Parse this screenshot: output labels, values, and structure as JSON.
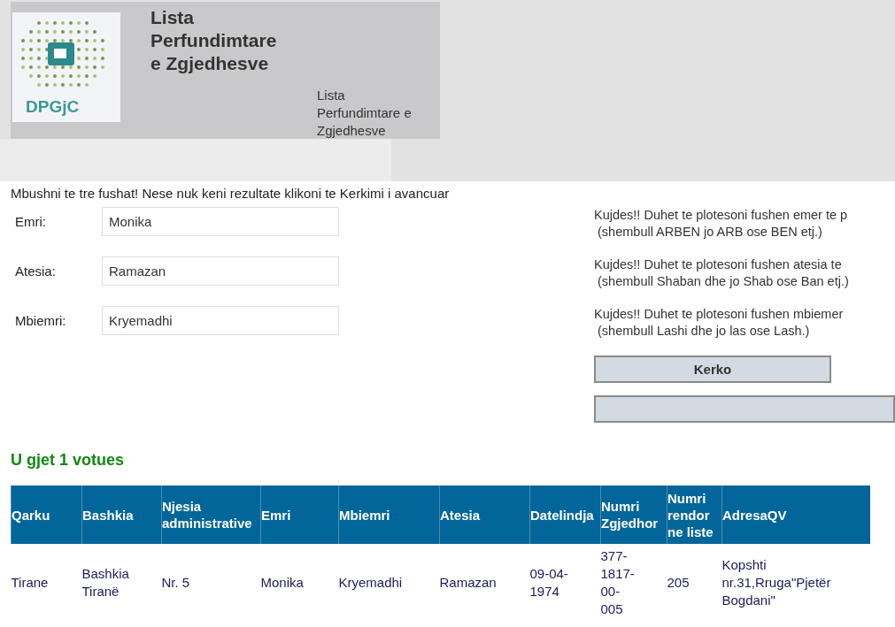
{
  "header": {
    "logo_text": "DPGjC",
    "title": "Lista Perfundimtare e Zgjedhesve",
    "subtitle": "Lista Perfundimtare e Zgjedhesve"
  },
  "instruction": "Mbushni te tre fushat! Nese nuk keni rezultate klikoni te Kerkimi i avancuar",
  "fields": [
    {
      "label": "Emri:",
      "value": "Monika"
    },
    {
      "label": "Atesia:",
      "value": "Ramazan"
    },
    {
      "label": "Mbiemri:",
      "value": "Kryemadhi"
    }
  ],
  "warnings": [
    {
      "line1": "Kujdes!! Duhet te plotesoni fushen emer te p",
      "line2": "(shembull ARBEN jo ARB ose BEN etj.)"
    },
    {
      "line1": "Kujdes!! Duhet te plotesoni fushen atesia te",
      "line2": "(shembull Shaban dhe jo Shab ose Ban etj.)"
    },
    {
      "line1": "Kujdes!! Duhet te plotesoni fushen mbiemer",
      "line2": "(shembull Lashi dhe jo las ose Lash.)"
    }
  ],
  "buttons": [
    {
      "kind": "labeled",
      "label": "Kerko"
    },
    {
      "kind": "blank"
    }
  ],
  "result": "U gjet 1 votues",
  "table": {
    "columns": [
      "Qarku",
      "Bashkia",
      "Njesia administrative",
      "Emri",
      "Mbiemri",
      "Atesia",
      "Datelindja",
      "Numri Zgjedhor",
      "Numri rendor ne liste",
      "AdresaQV"
    ],
    "rows": [
      [
        "Tirane",
        "Bashkia Tiranë",
        "Nr. 5",
        "Monika",
        "Kryemadhi",
        "Ramazan",
        "09-04-1974",
        "377-1817-00-005",
        "205",
        "Kopshti nr.31,Rruga\"Pjetër Bogdani\""
      ]
    ]
  }
}
